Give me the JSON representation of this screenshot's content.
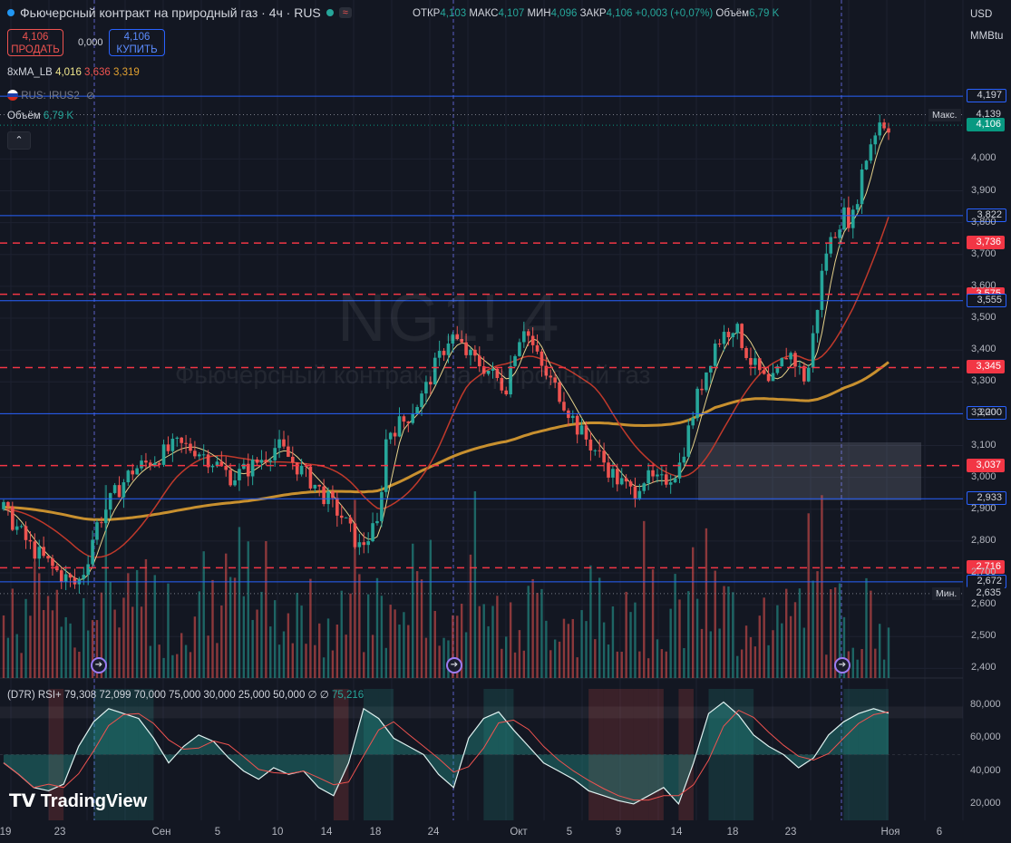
{
  "header": {
    "title": "Фьючерсный контракт на природный газ · 4ч · RUS",
    "ohlc": [
      {
        "k": "ОТКР",
        "v": "4,103"
      },
      {
        "k": "МАКС",
        "v": "4,107"
      },
      {
        "k": "МИН",
        "v": "4,096"
      },
      {
        "k": "ЗАКР",
        "v": "4,106 +0,003 (+0,07%)"
      },
      {
        "k": "Объём",
        "v": "6,79 K"
      }
    ],
    "sell_price": "4,106",
    "sell_label": "ПРОДАТЬ",
    "buy_price": "4,106",
    "buy_label": "КУПИТЬ",
    "spread": "0,000"
  },
  "indicators": {
    "ma_name": "8xMA_LB",
    "ma_values": [
      "4,016",
      "3,636",
      "3,319"
    ],
    "symbol_line": "RUS: IRUS2",
    "volume_label": "Объём",
    "volume_value": "6,79 K",
    "rsi_label": "(D7R) RSI+",
    "rsi_params": "79,308 72,099 70,000 75,000 30,000 25,000 50,000 ∅ ∅",
    "rsi_value": "75,216"
  },
  "currency": [
    "USD",
    "MMBtu"
  ],
  "watermark": {
    "symbol": "NG1! 4",
    "name": "Фьючерсный контракт на природный газ"
  },
  "brand": "TradingView",
  "colors": {
    "up": "#26a69a",
    "down": "#ef5350",
    "ma200": "#c8902f",
    "blue": "#2962ff",
    "red_dash": "#f23645"
  },
  "chart_data": [
    {
      "type": "candlestick",
      "title": "",
      "ylim": [
        2.35,
        4.3
      ],
      "y_ticks": [
        "4,000",
        "3,900",
        "3,800",
        "3,700",
        "3,600",
        "3,500",
        "3,400",
        "3,300",
        "3,200",
        "3,100",
        "3,000",
        "2,900",
        "2,800",
        "2,700",
        "2,600",
        "2,500",
        "2,400"
      ],
      "x_ticks": [
        "19",
        "23",
        "Сен",
        "5",
        "10",
        "14",
        "18",
        "24",
        "Окт",
        "5",
        "9",
        "14",
        "18",
        "23",
        "Ноя",
        "6"
      ],
      "close_path": [
        [
          0,
          2.9
        ],
        [
          3,
          2.78
        ],
        [
          6,
          2.7
        ],
        [
          8,
          2.66
        ],
        [
          9,
          2.72
        ],
        [
          10,
          2.84
        ],
        [
          12,
          2.94
        ],
        [
          14,
          3.02
        ],
        [
          16,
          3.05
        ],
        [
          19,
          3.1
        ],
        [
          21,
          3.09
        ],
        [
          23,
          3.05
        ],
        [
          25,
          3.0
        ],
        [
          27,
          3.03
        ],
        [
          30,
          3.1
        ],
        [
          32,
          3.04
        ],
        [
          34,
          2.98
        ],
        [
          37,
          2.88
        ],
        [
          39,
          2.78
        ],
        [
          41,
          2.85
        ],
        [
          42,
          3.14
        ],
        [
          44,
          3.18
        ],
        [
          46,
          3.26
        ],
        [
          47,
          3.33
        ],
        [
          49,
          3.45
        ],
        [
          51,
          3.38
        ],
        [
          53,
          3.34
        ],
        [
          55,
          3.28
        ],
        [
          56,
          3.4
        ],
        [
          57,
          3.48
        ],
        [
          59,
          3.34
        ],
        [
          61,
          3.26
        ],
        [
          63,
          3.15
        ],
        [
          65,
          3.08
        ],
        [
          67,
          3.0
        ],
        [
          69,
          2.95
        ],
        [
          70,
          3.0
        ],
        [
          72,
          2.98
        ],
        [
          74,
          3.03
        ],
        [
          76,
          3.25
        ],
        [
          78,
          3.42
        ],
        [
          80,
          3.48
        ],
        [
          82,
          3.36
        ],
        [
          84,
          3.28
        ],
        [
          86,
          3.4
        ],
        [
          88,
          3.3
        ],
        [
          90,
          3.7
        ],
        [
          92,
          3.83
        ],
        [
          93,
          3.8
        ],
        [
          94,
          3.95
        ],
        [
          95,
          4.05
        ],
        [
          96,
          4.12
        ],
        [
          97,
          4.106
        ]
      ],
      "volume_range": [
        0,
        0.5
      ]
    },
    {
      "type": "line",
      "title": "(D7R) RSI+",
      "ylim": [
        10,
        90
      ],
      "y_ticks": [
        "80,000",
        "60,000",
        "40,000",
        "20,000"
      ],
      "values": [
        45,
        38,
        30,
        28,
        32,
        55,
        70,
        78,
        75,
        72,
        60,
        45,
        55,
        62,
        58,
        48,
        40,
        35,
        42,
        38,
        40,
        30,
        25,
        45,
        78,
        72,
        60,
        55,
        50,
        38,
        30,
        60,
        72,
        76,
        65,
        55,
        45,
        40,
        35,
        28,
        25,
        22,
        20,
        25,
        30,
        20,
        45,
        75,
        82,
        74,
        62,
        55,
        50,
        42,
        48,
        62,
        70,
        75,
        78,
        75.2
      ]
    }
  ],
  "price_levels": [
    {
      "value": "4,197",
      "color": "blue",
      "style": "solid"
    },
    {
      "value": "4,139",
      "color": "dark",
      "style": "dotted",
      "label": "Макс."
    },
    {
      "value": "4,106",
      "color": "green",
      "style": "dotted"
    },
    {
      "value": "3,822",
      "color": "blue",
      "style": "solid"
    },
    {
      "value": "3,736",
      "color": "red",
      "style": "dash"
    },
    {
      "value": "3,575",
      "color": "red",
      "style": "dash"
    },
    {
      "value": "3,555",
      "color": "blue",
      "style": "solid"
    },
    {
      "value": "3,345",
      "color": "red",
      "style": "dash"
    },
    {
      "value": "3,200",
      "color": "blue",
      "style": "solid"
    },
    {
      "value": "3,037",
      "color": "red",
      "style": "dash"
    },
    {
      "value": "2,933",
      "color": "blue",
      "style": "solid"
    },
    {
      "value": "2,716",
      "color": "red",
      "style": "dash"
    },
    {
      "value": "2,672",
      "color": "blue",
      "style": "solid"
    },
    {
      "value": "2,635",
      "color": "dark",
      "style": "dotted",
      "label": "Мин."
    }
  ]
}
